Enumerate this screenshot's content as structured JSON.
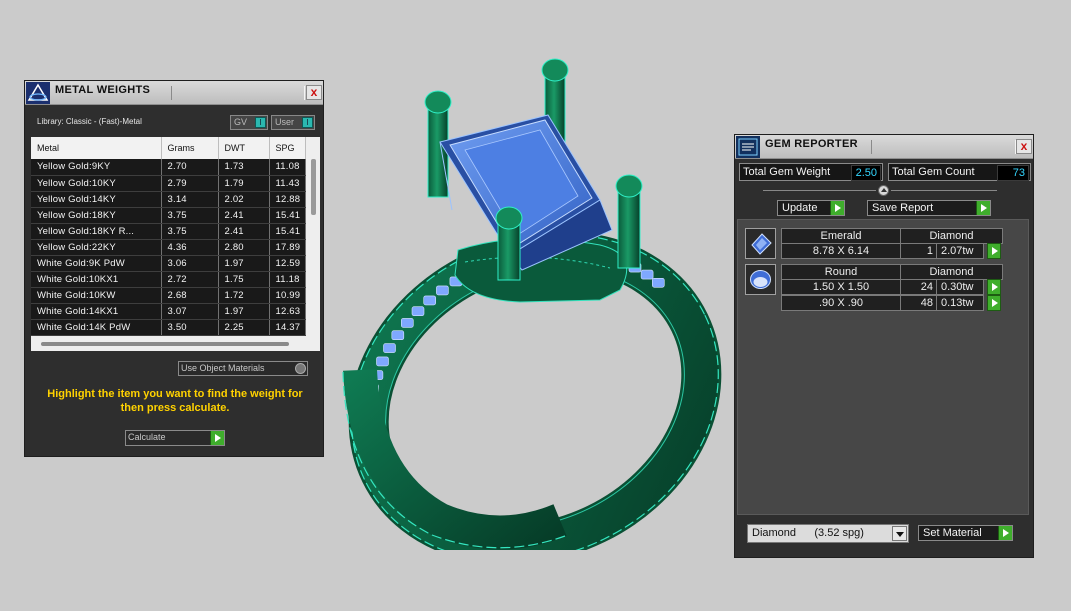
{
  "metal_panel": {
    "title": "METAL WEIGHTS",
    "close": "x",
    "library": "Library: Classic - (Fast)-Metal",
    "gv_label": "GV",
    "user_label": "User",
    "toggle_glyph": "I",
    "columns": [
      "Metal",
      "Grams",
      "DWT",
      "SPG"
    ],
    "rows": [
      [
        "Yellow Gold:9KY",
        "2.70",
        "1.73",
        "11.08"
      ],
      [
        "Yellow Gold:10KY",
        "2.79",
        "1.79",
        "11.43"
      ],
      [
        "Yellow Gold:14KY",
        "3.14",
        "2.02",
        "12.88"
      ],
      [
        "Yellow Gold:18KY",
        "3.75",
        "2.41",
        "15.41"
      ],
      [
        "Yellow Gold:18KY R...",
        "3.75",
        "2.41",
        "15.41"
      ],
      [
        "Yellow Gold:22KY",
        "4.36",
        "2.80",
        "17.89"
      ],
      [
        "White Gold:9K PdW",
        "3.06",
        "1.97",
        "12.59"
      ],
      [
        "White Gold:10KX1",
        "2.72",
        "1.75",
        "11.18"
      ],
      [
        "White Gold:10KW",
        "2.68",
        "1.72",
        "10.99"
      ],
      [
        "White Gold:14KX1",
        "3.07",
        "1.97",
        "12.63"
      ],
      [
        "White Gold:14K PdW",
        "3.50",
        "2.25",
        "14.37"
      ]
    ],
    "use_object_materials": "Use Object Materials",
    "hint": "Highlight the item you want to find the weight for then press calculate.",
    "calculate": "Calculate"
  },
  "gem_panel": {
    "title": "GEM REPORTER",
    "close": "x",
    "total_weight_label": "Total Gem Weight",
    "total_weight_value": "2.50",
    "total_count_label": "Total Gem Count",
    "total_count_value": "73",
    "update": "Update",
    "save_report": "Save Report",
    "groups": [
      {
        "icon": "emerald-cut-gem-icon",
        "shape": "Emerald",
        "material": "Diamond",
        "rows": [
          {
            "size": "8.78 X 6.14",
            "count": "1",
            "weight": "2.07tw"
          }
        ]
      },
      {
        "icon": "round-gem-icon",
        "shape": "Round",
        "material": "Diamond",
        "rows": [
          {
            "size": "1.50 X 1.50",
            "count": "24",
            "weight": "0.30tw"
          },
          {
            "size": ".90 X .90",
            "count": "48",
            "weight": "0.13tw"
          }
        ]
      }
    ],
    "material_select": "Diamond      (3.52 spg)",
    "set_material": "Set Material"
  },
  "colors": {
    "ring_metal": "#0b5e3f",
    "ring_edge": "#2ff0c8",
    "gem_blue": "#4a7fe0",
    "hint_yellow": "#ffd200",
    "value_cyan": "#33d6ff",
    "go_green": "#3fae2c"
  }
}
